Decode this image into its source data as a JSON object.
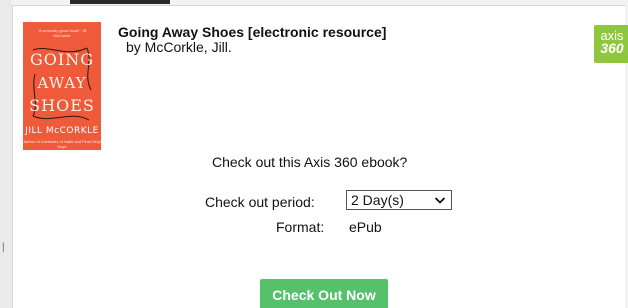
{
  "book": {
    "title": "Going Away Shoes [electronic resource]",
    "byline": "by McCorkle, Jill.",
    "cover": {
      "blurb": "\"A seriously good book!\" Jill McCorkle",
      "title_line1": "GOING",
      "title_line2": "AWAY",
      "title_line3": "SHOES",
      "author": "JILL McCORKLE",
      "footer": "Author of Creatures of Habit and Final Vinyl Days"
    }
  },
  "provider_logo": {
    "line1": "axis",
    "line2": "360"
  },
  "checkout": {
    "prompt": "Check out this Axis 360 ebook?",
    "period_label": "Check out period:",
    "period_value": "2 Day(s)",
    "format_label": "Format:",
    "format_value": "ePub",
    "button_label": "Check Out Now"
  },
  "colors": {
    "cover_bg": "#ef5a3b",
    "logo_green": "#8ec63f",
    "button_green": "#55c26b"
  }
}
